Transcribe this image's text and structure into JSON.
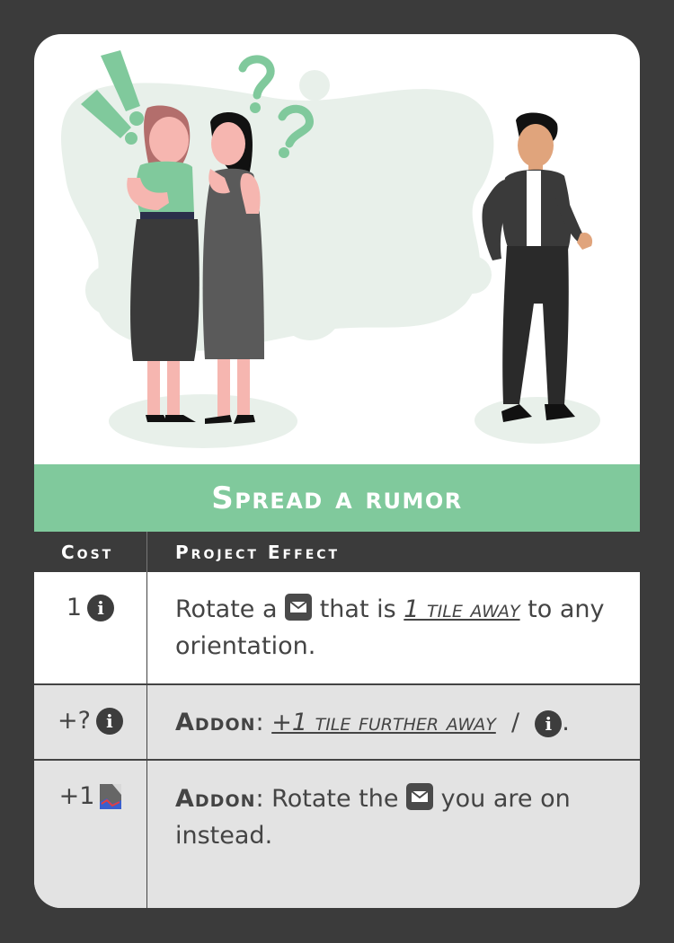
{
  "title": "Spread a rumor",
  "table": {
    "headers": {
      "cost": "Cost",
      "effect": "Project Effect"
    },
    "rows": [
      {
        "cost": "1",
        "cost_icon": "info-icon",
        "effect": {
          "part1": "Rotate a",
          "icon": "mail-icon",
          "part2": "that is",
          "distance": "1 tile away",
          "part3": "to any orientation."
        }
      },
      {
        "cost": "+?",
        "cost_icon": "info-icon",
        "effect": {
          "addon": "Addon",
          "colon": ":",
          "distance": "+1 tile further away",
          "slash": "/",
          "end": "."
        }
      },
      {
        "cost": "+1",
        "cost_icon": "tile-icon",
        "effect": {
          "addon": "Addon",
          "text1": ": Rotate the",
          "icon": "mail-icon",
          "text2": "you are on instead."
        }
      }
    ]
  },
  "colors": {
    "accent": "#80c99c",
    "background": "#3b3b3b",
    "row_alt": "#e3e3e3",
    "text": "#444444"
  },
  "illustration": {
    "symbols": [
      "!",
      "!",
      "?",
      "?"
    ]
  }
}
